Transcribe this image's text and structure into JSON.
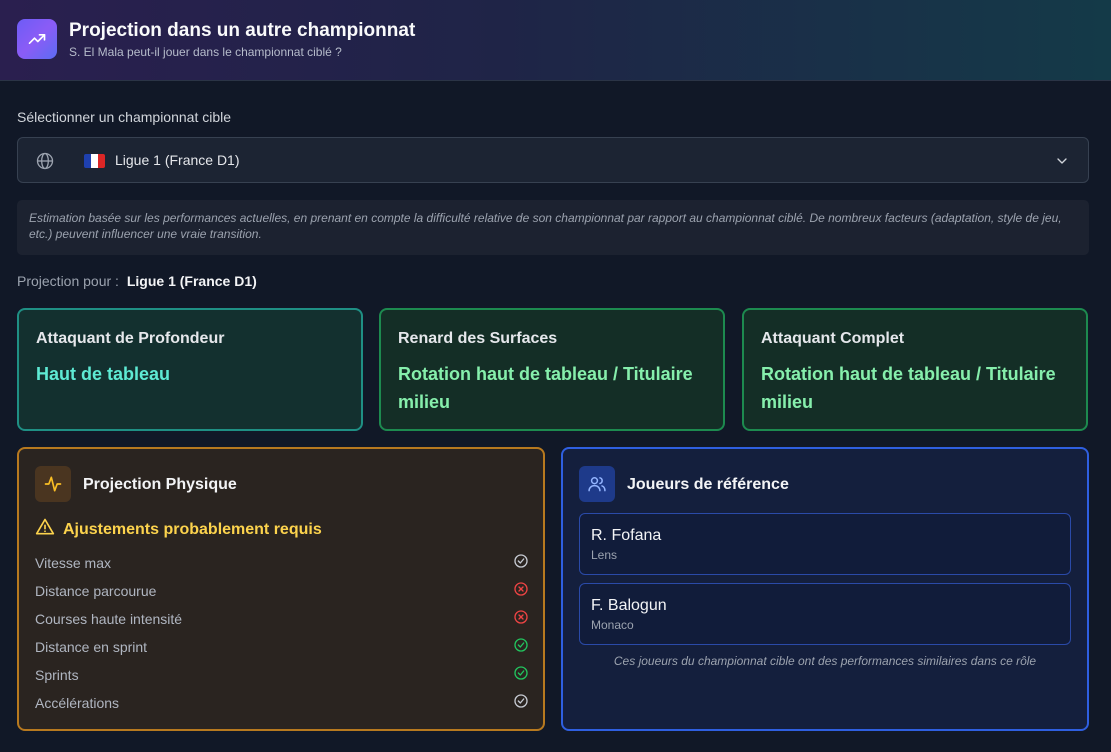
{
  "header": {
    "title": "Projection dans un autre championnat",
    "subtitle": "S. El Mala peut-il jouer dans le championnat ciblé ?"
  },
  "selector": {
    "label": "Sélectionner un championnat cible",
    "value": "Ligue 1 (France D1)",
    "flag_colors": [
      "#1e40af",
      "#ffffff",
      "#dc2626"
    ]
  },
  "disclaimer": "Estimation basée sur les performances actuelles, en prenant en compte la difficulté relative de son championnat par rapport au championnat ciblé. De nombreux facteurs (adaptation, style de jeu, etc.) peuvent influencer une vraie transition.",
  "projection": {
    "prefix": "Projection pour :",
    "league": "Ligue 1 (France D1)"
  },
  "roles": [
    {
      "title": "Attaquant de Profondeur",
      "value": "Haut de tableau"
    },
    {
      "title": "Renard des Surfaces",
      "value": "Rotation haut de tableau / Titulaire milieu"
    },
    {
      "title": "Attaquant Complet",
      "value": "Rotation haut de tableau / Titulaire milieu"
    }
  ],
  "physical": {
    "title": "Projection Physique",
    "warning": "Ajustements probablement requis",
    "metrics": [
      {
        "label": "Vitesse max",
        "status": "neutral-check"
      },
      {
        "label": "Distance parcourue",
        "status": "fail"
      },
      {
        "label": "Courses haute intensité",
        "status": "fail"
      },
      {
        "label": "Distance en sprint",
        "status": "pass"
      },
      {
        "label": "Sprints",
        "status": "pass"
      },
      {
        "label": "Accélérations",
        "status": "neutral-check"
      }
    ]
  },
  "references": {
    "title": "Joueurs de référence",
    "players": [
      {
        "name": "R. Fofana",
        "club": "Lens"
      },
      {
        "name": "F. Balogun",
        "club": "Monaco"
      }
    ],
    "note": "Ces joueurs du championnat cible ont des performances similaires dans ce rôle"
  }
}
